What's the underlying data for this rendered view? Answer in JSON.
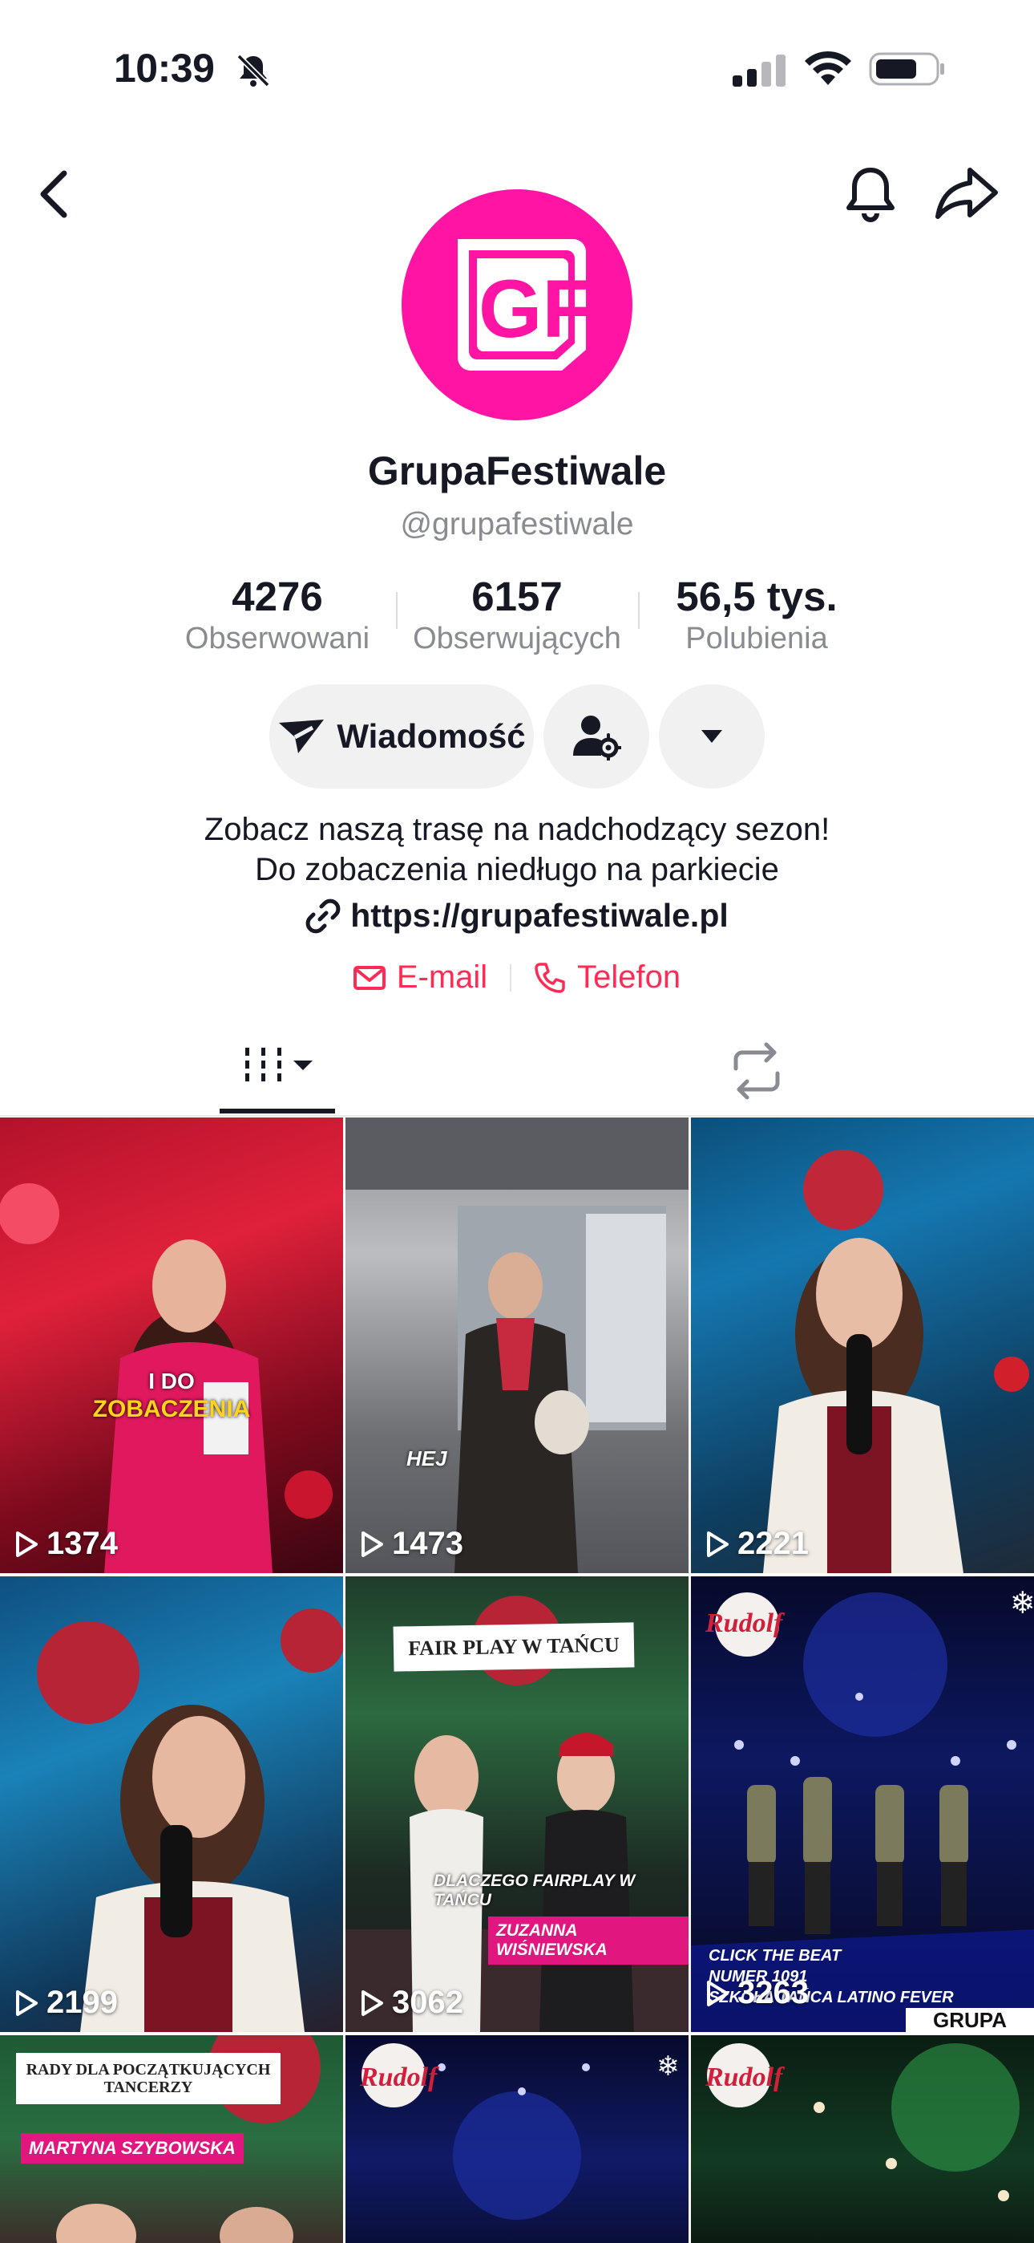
{
  "status_bar": {
    "time": "10:39",
    "icons": [
      "mute-bell-icon",
      "cellular-signal-icon",
      "wifi-icon",
      "battery-icon"
    ]
  },
  "header": {
    "back_icon": "chevron-left-icon",
    "bell_icon": "bell-icon",
    "share_icon": "share-arrow-icon"
  },
  "profile": {
    "avatar_logo_text": "GF",
    "display_name": "GrupaFestiwale",
    "handle": "@grupafestiwale",
    "brand_color": "#ff14a3"
  },
  "stats": [
    {
      "value": "4276",
      "label": "Obserwowani"
    },
    {
      "value": "6157",
      "label": "Obserwujących"
    },
    {
      "value": "56,5 tys.",
      "label": "Polubienia"
    }
  ],
  "actions": {
    "message_label": "Wiadomość",
    "message_icon": "send-icon",
    "add_friend_icon": "user-settings-icon",
    "more_icon": "caret-down-icon"
  },
  "bio": {
    "line1": "Zobacz naszą trasę na nadchodzący sezon!",
    "line2": "Do zobaczenia niedługo na parkiecie",
    "link": "https://grupafestiwale.pl",
    "link_icon": "link-icon"
  },
  "contacts": {
    "email_label": "E-mail",
    "phone_label": "Telefon",
    "accent_color": "#fe2c55"
  },
  "tabs": {
    "videos_icon": "videos-grid-icon",
    "reposts_icon": "repost-icon"
  },
  "videos": [
    {
      "views": "1374",
      "caption_a": "I DO",
      "caption_b": "ZOBACZENIA"
    },
    {
      "views": "1473",
      "caption": "HEJ"
    },
    {
      "views": "2221"
    },
    {
      "views": "2199"
    },
    {
      "views": "3062",
      "banner": "FAIR PLAY W TAŃCU",
      "caption": "DLACZEGO FAIRPLAY W TAŃCU",
      "name_tag": "ZUZANNA WIŚNIEWSKA"
    },
    {
      "views": "3263",
      "badge": "Rudolf",
      "caption_lines": [
        "CLICK THE BEAT",
        "NUMER 1091",
        "SZKOŁA TAŃCA LATINO FEVER"
      ],
      "corner_text": "GRUPA"
    },
    {
      "banner": "RADY DLA POCZĄTKUJĄCYCH TANCERZY",
      "name_tag": "MARTYNA SZYBOWSKA"
    },
    {
      "badge": "Rudolf"
    },
    {
      "badge": "Rudolf"
    }
  ]
}
